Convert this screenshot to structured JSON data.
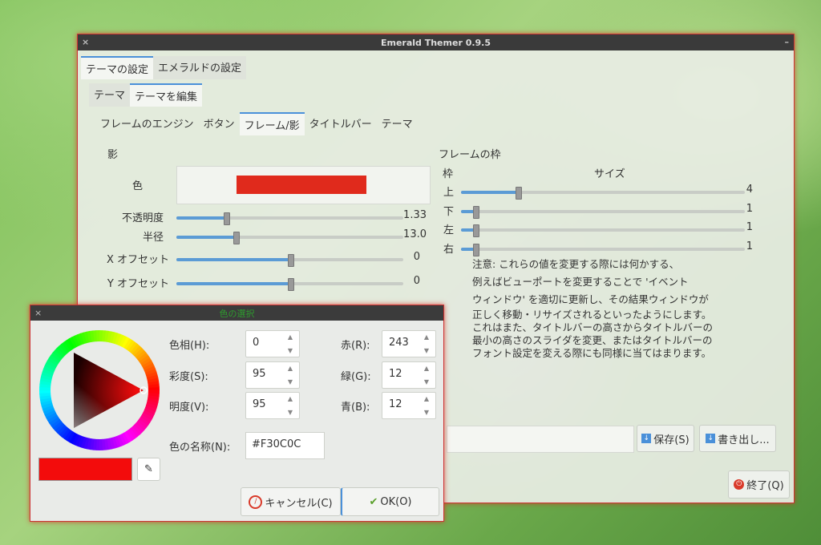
{
  "window": {
    "title": "Emerald Themer 0.9.5"
  },
  "tabs_top": [
    "テーマの設定",
    "エメラルドの設定"
  ],
  "tabs_second": [
    "テーマ",
    "テーマを編集"
  ],
  "tabs_third": [
    "フレームのエンジン",
    "ボタン",
    "フレーム/影",
    "タイトルバー",
    "テーマ"
  ],
  "shadow": {
    "heading": "影",
    "color_label": "色",
    "color_value": "#e02a1c",
    "rows": [
      {
        "label": "不透明度",
        "value": "1.33",
        "fraction": 0.22
      },
      {
        "label": "半径",
        "value": "13.0",
        "fraction": 0.26
      },
      {
        "label": "X オフセット",
        "value": "0",
        "fraction": 0.5
      },
      {
        "label": "Y オフセット",
        "value": "0",
        "fraction": 0.5
      }
    ]
  },
  "frame": {
    "heading": "フレームの枠",
    "col_frame": "枠",
    "col_size": "サイズ",
    "rows": [
      {
        "label": "上",
        "value": "4",
        "fraction": 0.2
      },
      {
        "label": "下",
        "value": "1",
        "fraction": 0.05
      },
      {
        "label": "左",
        "value": "1",
        "fraction": 0.05
      },
      {
        "label": "右",
        "value": "1",
        "fraction": 0.05
      }
    ],
    "note": [
      "注意: これらの値を変更する際には何かする、",
      "例えばビューポートを変更することで 'イベント",
      "ウィンドウ' を適切に更新し、その結果ウィンドウが",
      "正しく移動・リサイズされるといったようにします。",
      "これはまた、タイトルバーの高さからタイトルバーの",
      "最小の高さのスライダを変更、またはタイトルバーの",
      "フォント設定を変える際にも同様に当てはまります。"
    ]
  },
  "buttons": {
    "save": "保存(S)",
    "export": "書き出し...",
    "quit": "終了(Q)"
  },
  "color_dialog": {
    "title": "色の選択",
    "hue_label": "色相(H):",
    "hue": "0",
    "sat_label": "彩度(S):",
    "sat": "95",
    "val_label": "明度(V):",
    "val": "95",
    "red_label": "赤(R):",
    "red": "243",
    "green_label": "緑(G):",
    "green": "12",
    "blue_label": "青(B):",
    "blue": "12",
    "name_label": "色の名称(N):",
    "name": "#F30C0C",
    "preview_color": "#f30c0c",
    "cancel": "キャンセル(C)",
    "ok": "OK(O)"
  }
}
